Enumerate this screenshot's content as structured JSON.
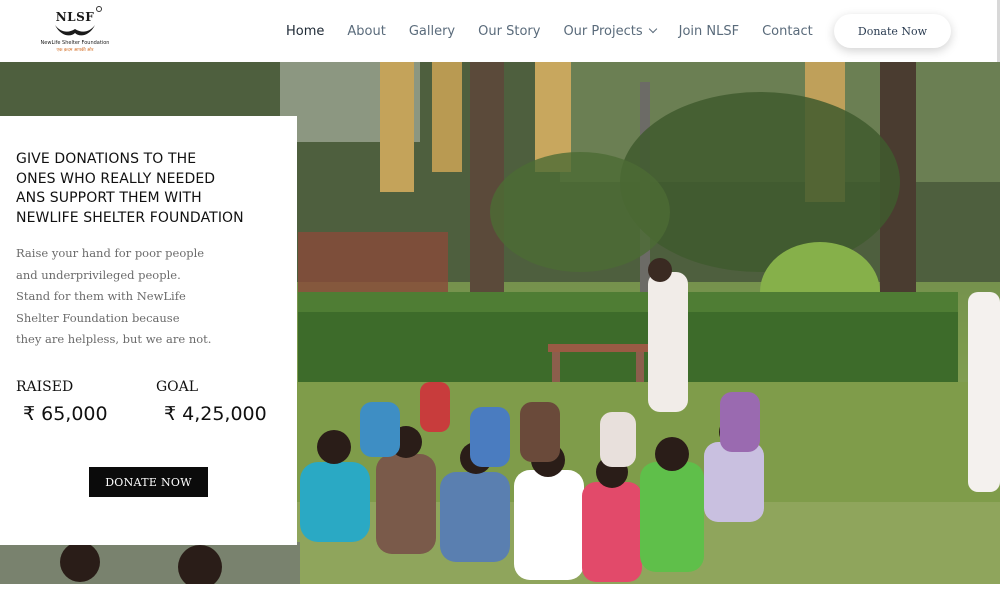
{
  "header": {
    "logo": {
      "mark": "NLSF",
      "name": "NewLife Shelter Foundation",
      "tagline": "एक क़दम आपकी ओर"
    },
    "nav": [
      {
        "label": "Home",
        "active": true
      },
      {
        "label": "About"
      },
      {
        "label": "Gallery"
      },
      {
        "label": "Our Story"
      },
      {
        "label": "Our Projects",
        "has_dropdown": true
      },
      {
        "label": "Join NLSF"
      },
      {
        "label": "Contact"
      }
    ],
    "donate_label": "Donate Now"
  },
  "hero": {
    "image_alt_icon": "photo-children-in-park"
  },
  "card": {
    "title_lines": [
      "GIVE DONATIONS TO THE",
      "ONES WHO REALLY NEEDED",
      "ANS SUPPORT THEM WITH",
      "NEWLIFE SHELTER FOUNDATION"
    ],
    "body_lines": [
      "Raise your hand for poor people",
      "and underprivileged people.",
      "Stand for them with NewLife",
      "Shelter Foundation because",
      "they are helpless, but we are not."
    ],
    "raised_label": "RAISED",
    "raised_value": "₹ 65,000",
    "goal_label": "GOAL",
    "goal_value": "₹ 4,25,000",
    "donate_label": "DONATE NOW"
  },
  "colors": {
    "nav_text": "#5a6b7b",
    "nav_active": "#1f2a36",
    "button_dark": "#0b0b0b",
    "accent_orange": "#d2691e"
  }
}
